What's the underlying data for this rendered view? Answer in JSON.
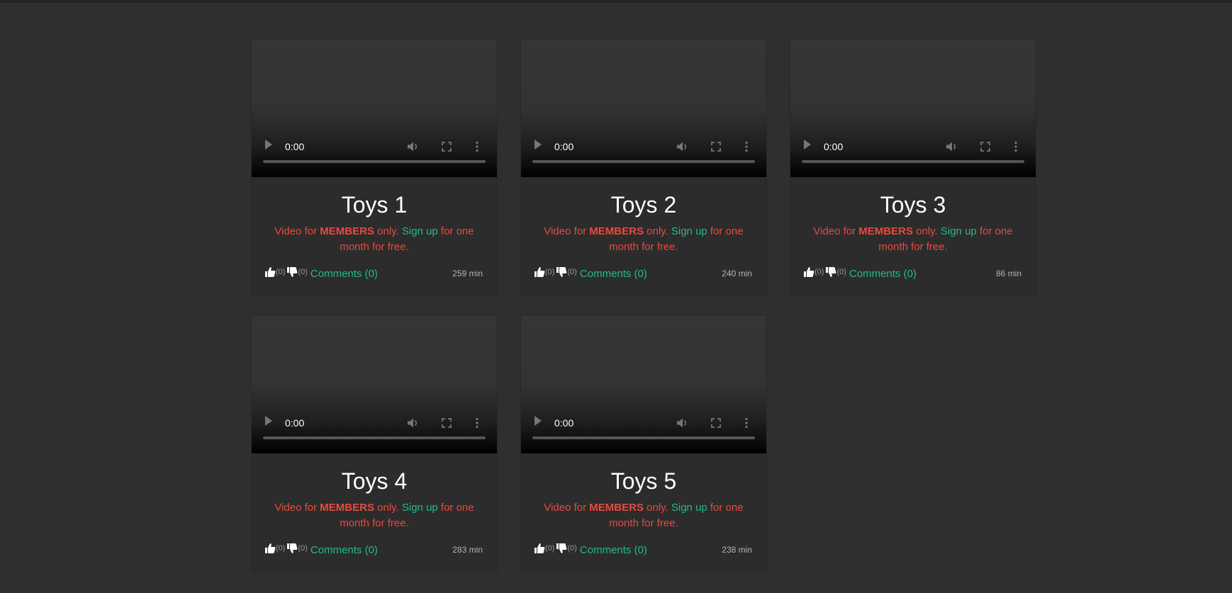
{
  "colors": {
    "page_bg": "#2f2f2f",
    "card_bg": "#2c2c2c",
    "members_text": "#e84a3f",
    "link": "#27b98f"
  },
  "videos": [
    {
      "title": "Toys 1",
      "player": {
        "time": "0:00"
      },
      "notice": {
        "prefix": "Video for ",
        "emphasis": "MEMBERS",
        "middle": " only. ",
        "link": "Sign up",
        "suffix": " for one month for free."
      },
      "likes": "(0)",
      "dislikes": "(0)",
      "comments": "Comments (0)",
      "duration": "259 min"
    },
    {
      "title": "Toys 2",
      "player": {
        "time": "0:00"
      },
      "notice": {
        "prefix": "Video for ",
        "emphasis": "MEMBERS",
        "middle": " only. ",
        "link": "Sign up",
        "suffix": " for one month for free."
      },
      "likes": "(0)",
      "dislikes": "(0)",
      "comments": "Comments (0)",
      "duration": "240 min"
    },
    {
      "title": "Toys 3",
      "player": {
        "time": "0:00"
      },
      "notice": {
        "prefix": "Video for ",
        "emphasis": "MEMBERS",
        "middle": " only. ",
        "link": "Sign up",
        "suffix": " for one month for free."
      },
      "likes": "(0)",
      "dislikes": "(0)",
      "comments": "Comments (0)",
      "duration": "86 min"
    },
    {
      "title": "Toys 4",
      "player": {
        "time": "0:00"
      },
      "notice": {
        "prefix": "Video for ",
        "emphasis": "MEMBERS",
        "middle": " only. ",
        "link": "Sign up",
        "suffix": " for one month for free."
      },
      "likes": "(0)",
      "dislikes": "(0)",
      "comments": "Comments (0)",
      "duration": "283 min"
    },
    {
      "title": "Toys 5",
      "player": {
        "time": "0:00"
      },
      "notice": {
        "prefix": "Video for ",
        "emphasis": "MEMBERS",
        "middle": " only. ",
        "link": "Sign up",
        "suffix": " for one month for free."
      },
      "likes": "(0)",
      "dislikes": "(0)",
      "comments": "Comments (0)",
      "duration": "238 min"
    }
  ]
}
